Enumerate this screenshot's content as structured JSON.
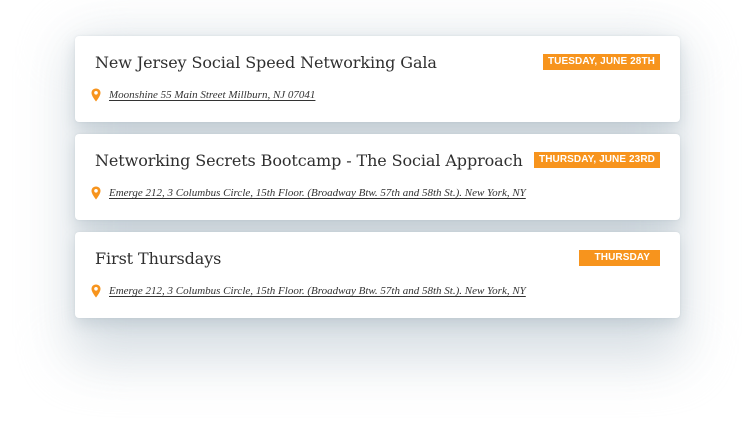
{
  "events": [
    {
      "title": "New Jersey Social Speed Networking Gala",
      "date_badge": "TUESDAY, JUNE 28TH",
      "address": "Moonshine 55 Main Street Millburn, NJ 07041",
      "icon": "location-pin-icon"
    },
    {
      "title": "Networking Secrets Bootcamp - The Social Approach",
      "date_badge": "THURSDAY, JUNE 23RD",
      "address": "Emerge 212, 3 Columbus Circle, 15th Floor. (Broadway Btw. 57th and 58th St.). New York, NY",
      "icon": "location-pin-icon"
    },
    {
      "title": "First Thursdays",
      "date_badge": "THURSDAY",
      "address": "Emerge 212, 3 Columbus Circle, 15th Floor. (Broadway Btw. 57th and 58th St.). New York, NY",
      "icon": "location-pin-icon"
    }
  ],
  "colors": {
    "accent": "#f7941d",
    "title_text": "#2f2f2f",
    "address_text": "#333333",
    "card_background": "#ffffff"
  }
}
